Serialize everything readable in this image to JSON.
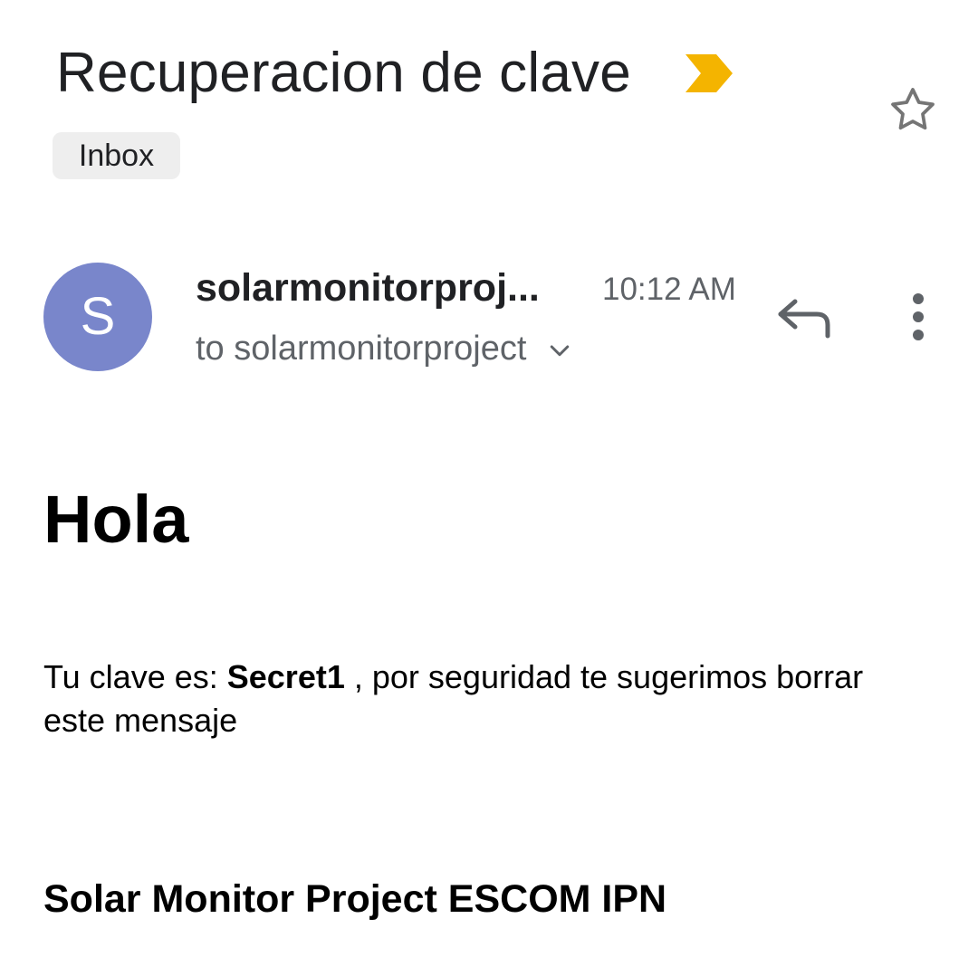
{
  "email": {
    "subject": "Recuperacion de clave",
    "importance_icon": "importance-marker-icon",
    "importance_color": "#f4b400",
    "label": "Inbox",
    "starred": false
  },
  "message": {
    "avatar_initial": "S",
    "avatar_color": "#7986cb",
    "sender": "solarmonitorproj...",
    "time": "10:12 AM",
    "recipient": "to solarmonitorproject",
    "body": {
      "greeting": "Hola",
      "line_prefix": "Tu clave es: ",
      "password": "Secret1",
      "line_suffix": " , por seguridad te sugerimos borrar este mensaje",
      "signature": "Solar Monitor Project ESCOM IPN"
    }
  },
  "icons": {
    "star": "star-outline-icon",
    "reply": "reply-icon",
    "more": "more-vertical-icon",
    "expand": "chevron-down-icon"
  }
}
